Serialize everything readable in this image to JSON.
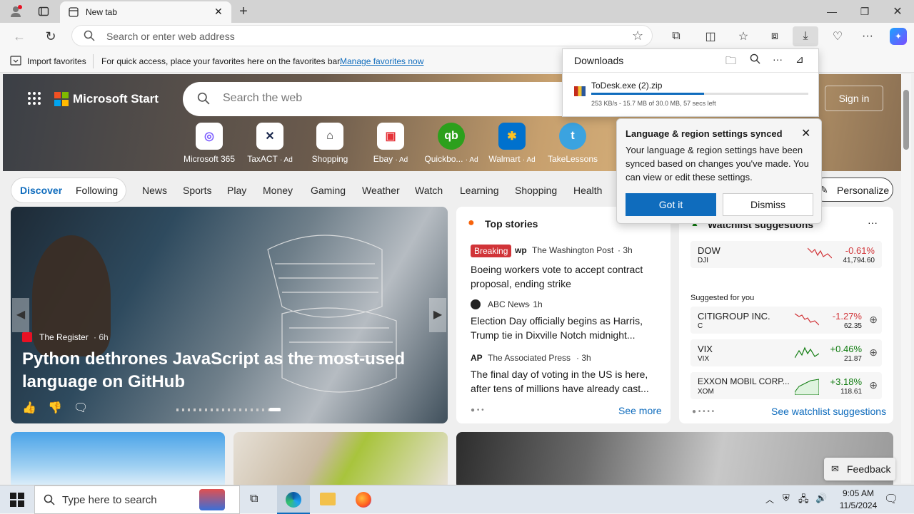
{
  "browser": {
    "tab_title": "New tab",
    "address_placeholder": "Search or enter web address",
    "favbar": {
      "import": "Import favorites",
      "hint": "For quick access, place your favorites here on the favorites bar.",
      "manage_link": "Manage favorites now"
    }
  },
  "downloads": {
    "title": "Downloads",
    "file_name": "ToDesk.exe (2).zip",
    "progress_fraction": 0.52,
    "status": "253 KB/s - 15.7 MB of 30.0 MB, 57 secs left"
  },
  "synced_popup": {
    "title": "Language & region settings synced",
    "body": "Your language & region settings have been synced based on changes you've made. You can view or edit these settings.",
    "got_it": "Got it",
    "dismiss": "Dismiss"
  },
  "msstart": {
    "brand": "Microsoft Start",
    "search_placeholder": "Search the web",
    "sign_in": "Sign in",
    "quick_links": [
      {
        "label": "Microsoft 365",
        "ad": ""
      },
      {
        "label": "TaxACT",
        "ad": "· Ad"
      },
      {
        "label": "Shopping",
        "ad": ""
      },
      {
        "label": "Ebay",
        "ad": "· Ad"
      },
      {
        "label": "Quickbo...",
        "ad": "· Ad"
      },
      {
        "label": "Walmart",
        "ad": "· Ad"
      },
      {
        "label": "TakeLessons",
        "ad": ""
      }
    ],
    "nav": {
      "discover": "Discover",
      "following": "Following",
      "items": [
        "News",
        "Sports",
        "Play",
        "Money",
        "Gaming",
        "Weather",
        "Watch",
        "Learning",
        "Shopping",
        "Health"
      ],
      "personalize": "Personalize"
    }
  },
  "hero_story": {
    "source": "The Register",
    "age": "· 6h",
    "headline": "Python dethrones JavaScript as the most-used language on GitHub"
  },
  "top_stories": {
    "title": "Top stories",
    "items": [
      {
        "badge": "Breaking",
        "source": "The Washington Post",
        "age": "· 3h",
        "headline": "Boeing workers vote to accept contract proposal, ending strike"
      },
      {
        "badge": "",
        "source": "ABC News",
        "age": "· 1h",
        "headline": "Election Day officially begins as Harris, Trump tie in Dixville Notch midnight..."
      },
      {
        "badge": "",
        "source": "The Associated Press",
        "age": "· 3h",
        "headline": "The final day of voting in the US is here, after tens of millions have already cast..."
      }
    ],
    "see_more": "See more"
  },
  "watchlist": {
    "title": "Watchlist suggestions",
    "suggested_label": "Suggested for you",
    "see_link": "See watchlist suggestions",
    "stocks": [
      {
        "name": "DOW",
        "ticker": "DJI",
        "change": "-0.61%",
        "price": "41,794.60",
        "dir": "down"
      },
      {
        "name": "CITIGROUP INC.",
        "ticker": "C",
        "change": "-1.27%",
        "price": "62.35",
        "dir": "down"
      },
      {
        "name": "VIX",
        "ticker": "VIX",
        "change": "+0.46%",
        "price": "21.87",
        "dir": "up"
      },
      {
        "name": "EXXON MOBIL CORP...",
        "ticker": "XOM",
        "change": "+3.18%",
        "price": "118.61",
        "dir": "up"
      }
    ]
  },
  "feedback": "Feedback",
  "taskbar": {
    "search_placeholder": "Type here to search",
    "time": "9:05 AM",
    "date": "11/5/2024"
  },
  "colors": {
    "accent": "#0f6cbd",
    "red": "#d13438",
    "green": "#107c10"
  }
}
